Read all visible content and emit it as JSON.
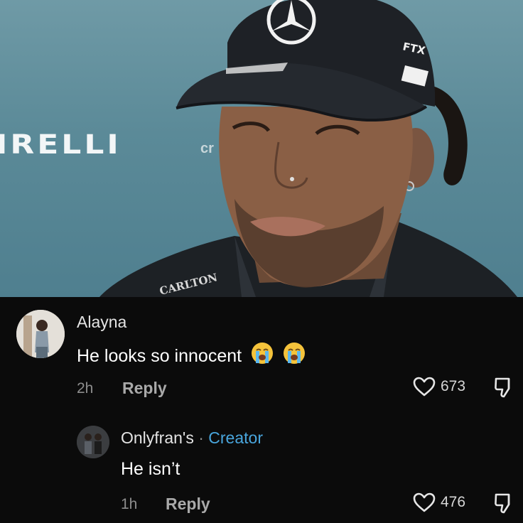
{
  "photo": {
    "sponsor_text": "IRELLI",
    "background_partial_text": "cr",
    "cap_sponsor_text": "FTX",
    "jacket_text": "CARLTON"
  },
  "comments": [
    {
      "author": "Alayna",
      "text": "He looks so innocent",
      "emoji": "loudly-crying-face-emoji",
      "time": "2h",
      "reply_label": "Reply",
      "likes": "673"
    },
    {
      "author": "Onlyfran's",
      "separator": " · ",
      "badge": "Creator",
      "text": "He isn’t",
      "time": "1h",
      "reply_label": "Reply",
      "likes": "476"
    }
  ],
  "icons": {
    "like": "heart-outline-icon",
    "dislike": "thumbs-down-icon"
  },
  "colors": {
    "background": "#0b0b0b",
    "creator_badge": "#49a6dd",
    "muted_text": "#8d8d8d"
  }
}
